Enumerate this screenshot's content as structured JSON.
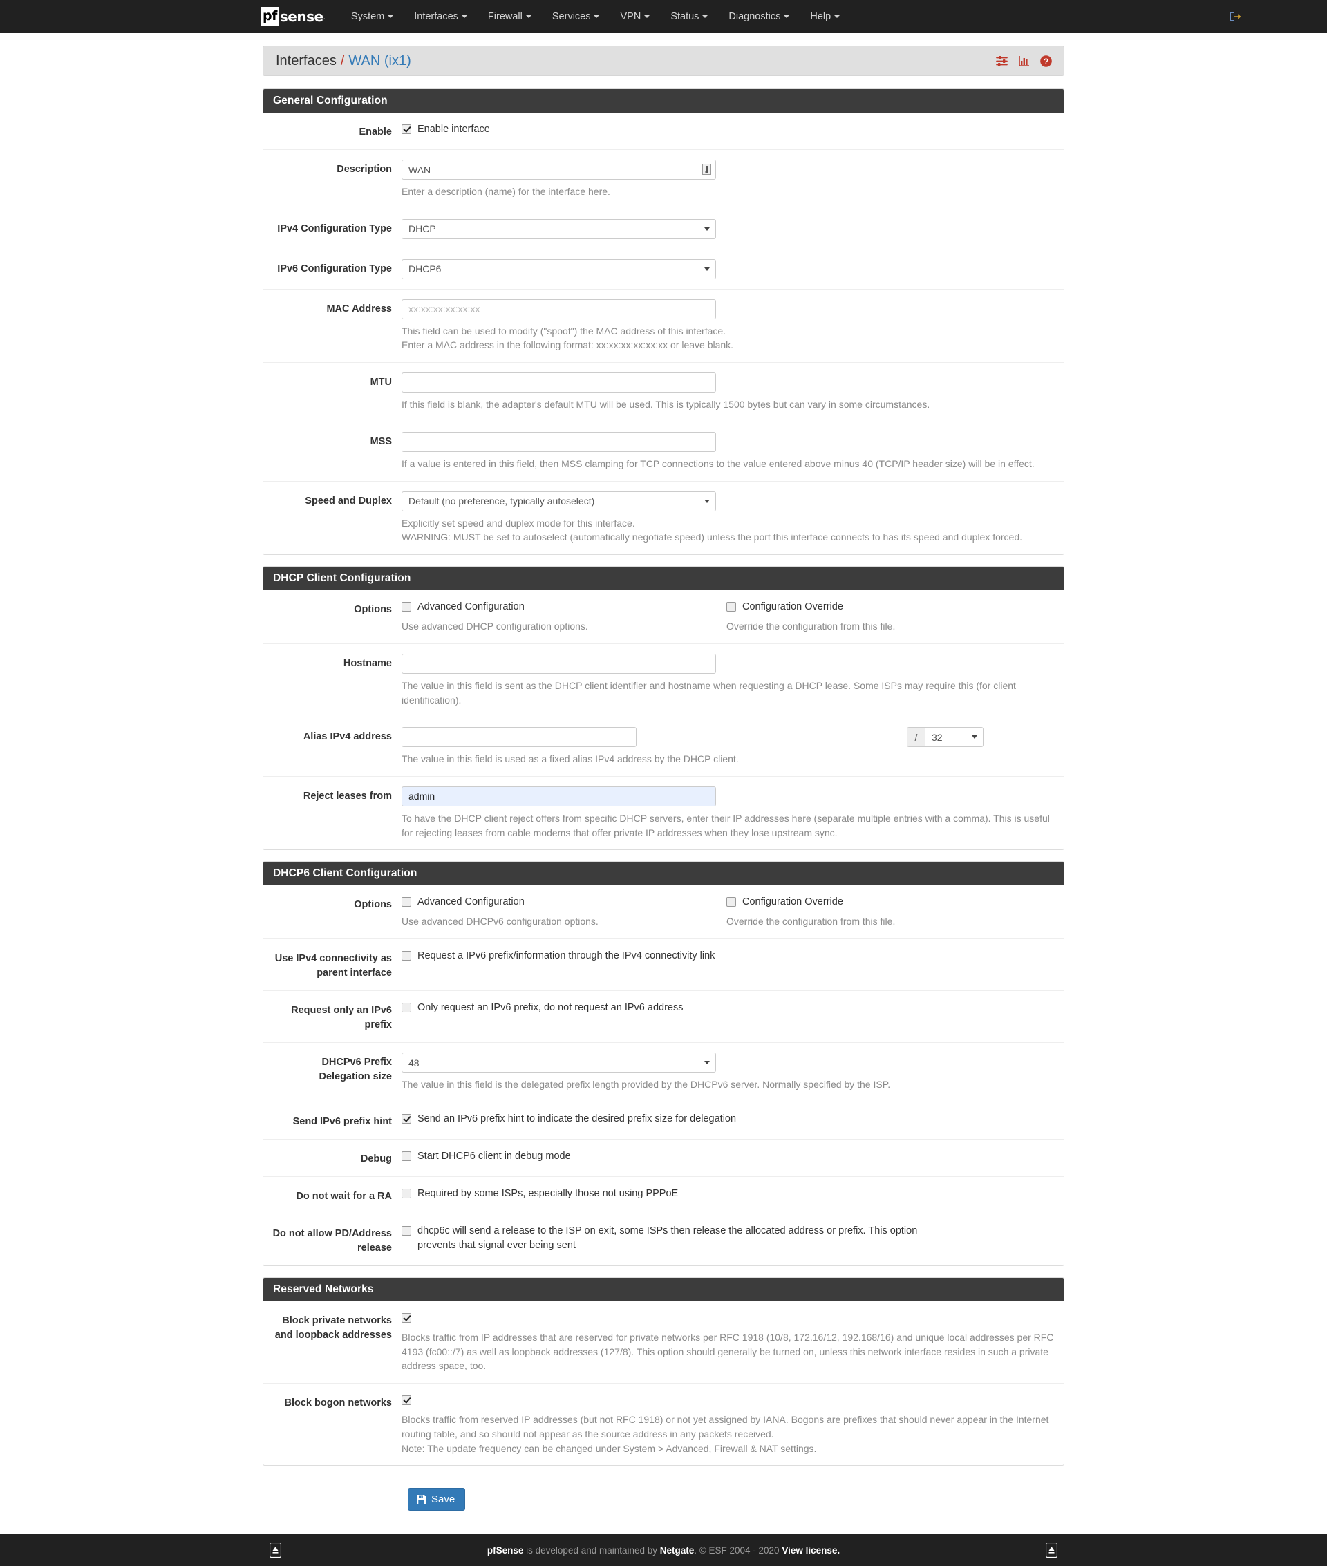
{
  "navbar": {
    "brand_prefix": "pf",
    "brand_rest": "sense",
    "items": [
      {
        "label": "System"
      },
      {
        "label": "Interfaces"
      },
      {
        "label": "Firewall"
      },
      {
        "label": "Services"
      },
      {
        "label": "VPN"
      },
      {
        "label": "Status"
      },
      {
        "label": "Diagnostics"
      },
      {
        "label": "Help"
      }
    ],
    "logout_icon": "sign-out-icon"
  },
  "breadcrumb": {
    "root": "Interfaces",
    "separator": "/",
    "current": "WAN (ix1)",
    "icons": [
      "sliders-icon",
      "bar-chart-icon",
      "help-circle-icon"
    ],
    "accent_red": "#c0392b",
    "accent_blue": "#337ab7"
  },
  "general": {
    "heading": "General Configuration",
    "enable": {
      "label": "Enable",
      "checkbox_label": "Enable interface",
      "checked": true
    },
    "description": {
      "label": "Description",
      "value": "WAN",
      "placeholder": "",
      "help": "Enter a description (name) for the interface here."
    },
    "ipv4_type": {
      "label": "IPv4 Configuration Type",
      "value": "DHCP"
    },
    "ipv6_type": {
      "label": "IPv6 Configuration Type",
      "value": "DHCP6"
    },
    "mac": {
      "label": "MAC Address",
      "value": "",
      "placeholder": "xx:xx:xx:xx:xx:xx",
      "help_line1": "This field can be used to modify (\"spoof\") the MAC address of this interface.",
      "help_line2": "Enter a MAC address in the following format: xx:xx:xx:xx:xx:xx or leave blank."
    },
    "mtu": {
      "label": "MTU",
      "value": "",
      "help": "If this field is blank, the adapter's default MTU will be used. This is typically 1500 bytes but can vary in some circumstances."
    },
    "mss": {
      "label": "MSS",
      "value": "",
      "help": "If a value is entered in this field, then MSS clamping for TCP connections to the value entered above minus 40 (TCP/IP header size) will be in effect."
    },
    "speed_duplex": {
      "label": "Speed and Duplex",
      "value": "Default (no preference, typically autoselect)",
      "help_line1": "Explicitly set speed and duplex mode for this interface.",
      "help_line2": "WARNING: MUST be set to autoselect (automatically negotiate speed) unless the port this interface connects to has its speed and duplex forced."
    }
  },
  "dhcp": {
    "heading": "DHCP Client Configuration",
    "options": {
      "label": "Options",
      "advanced_label": "Advanced Configuration",
      "advanced_checked": false,
      "advanced_help": "Use advanced DHCP configuration options.",
      "override_label": "Configuration Override",
      "override_checked": false,
      "override_help": "Override the configuration from this file."
    },
    "hostname": {
      "label": "Hostname",
      "value": "",
      "help": "The value in this field is sent as the DHCP client identifier and hostname when requesting a DHCP lease. Some ISPs may require this (for client identification)."
    },
    "alias": {
      "label": "Alias IPv4 address",
      "value": "",
      "slash": "/",
      "mask": "32",
      "help": "The value in this field is used as a fixed alias IPv4 address by the DHCP client."
    },
    "reject": {
      "label": "Reject leases from",
      "value": "admin",
      "help": "To have the DHCP client reject offers from specific DHCP servers, enter their IP addresses here (separate multiple entries with a comma). This is useful for rejecting leases from cable modems that offer private IP addresses when they lose upstream sync."
    }
  },
  "dhcp6": {
    "heading": "DHCP6 Client Configuration",
    "options": {
      "label": "Options",
      "advanced_label": "Advanced Configuration",
      "advanced_checked": false,
      "advanced_help": "Use advanced DHCPv6 configuration options.",
      "override_label": "Configuration Override",
      "override_checked": false,
      "override_help": "Override the configuration from this file."
    },
    "parent_iface": {
      "label": "Use IPv4 connectivity as parent interface",
      "checkbox_label": "Request a IPv6 prefix/information through the IPv4 connectivity link",
      "checked": false
    },
    "prefix_only": {
      "label": "Request only an IPv6 prefix",
      "checkbox_label": "Only request an IPv6 prefix, do not request an IPv6 address",
      "checked": false
    },
    "pd_size": {
      "label": "DHCPv6 Prefix Delegation size",
      "value": "48",
      "help": "The value in this field is the delegated prefix length provided by the DHCPv6 server. Normally specified by the ISP."
    },
    "prefix_hint": {
      "label": "Send IPv6 prefix hint",
      "checkbox_label": "Send an IPv6 prefix hint to indicate the desired prefix size for delegation",
      "checked": true
    },
    "debug": {
      "label": "Debug",
      "checkbox_label": "Start DHCP6 client in debug mode",
      "checked": false
    },
    "no_ra_wait": {
      "label": "Do not wait for a RA",
      "checkbox_label": "Required by some ISPs, especially those not using PPPoE",
      "checked": false
    },
    "no_release": {
      "label": "Do not allow PD/Address release",
      "checkbox_label": "dhcp6c will send a release to the ISP on exit, some ISPs then release the allocated address or prefix. This option prevents that signal ever being sent",
      "checked": false
    }
  },
  "reserved": {
    "heading": "Reserved Networks",
    "block_private": {
      "label": "Block private networks and loopback addresses",
      "checked": true,
      "help": "Blocks traffic from IP addresses that are reserved for private networks per RFC 1918 (10/8, 172.16/12, 192.168/16) and unique local addresses per RFC 4193 (fc00::/7) as well as loopback addresses (127/8). This option should generally be turned on, unless this network interface resides in such a private address space, too."
    },
    "block_bogon": {
      "label": "Block bogon networks",
      "checked": true,
      "help_line1": "Blocks traffic from reserved IP addresses (but not RFC 1918) or not yet assigned by IANA. Bogons are prefixes that should never appear in the Internet routing table, and so should not appear as the source address in any packets received.",
      "help_line2": "Note: The update frequency can be changed under System > Advanced, Firewall & NAT settings."
    }
  },
  "actions": {
    "save_label": "Save",
    "save_color": "#337ab7"
  },
  "footer": {
    "brand": "pfSense",
    "text_1": " is developed and maintained by ",
    "company": "Netgate",
    "text_2": ". © ESF 2004 - 2020 ",
    "license_link": "View license.",
    "scroll_icon": "scroll-top-icon"
  }
}
